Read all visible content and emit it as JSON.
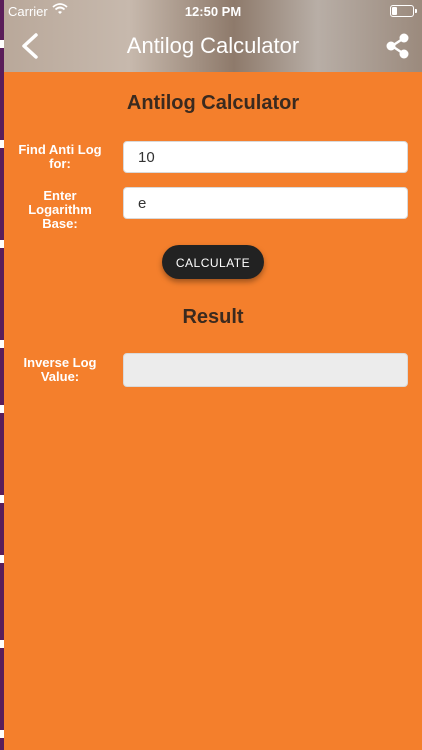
{
  "status_bar": {
    "carrier": "Carrier",
    "time": "12:50 PM"
  },
  "nav": {
    "title": "Antilog Calculator",
    "back_icon": "chevron-left-icon",
    "share_icon": "share-icon"
  },
  "form": {
    "heading": "Antilog Calculator",
    "antilog_label": "Find Anti Log for:",
    "antilog_value": "10",
    "base_label": "Enter Logarithm Base:",
    "base_value": "e",
    "calculate_label": "CALCULATE"
  },
  "result": {
    "heading": "Result",
    "inverse_label": "Inverse Log Value:",
    "inverse_value": ""
  },
  "colors": {
    "background": "#f47f2c",
    "button": "#222222",
    "heading_text": "#3a2a1f"
  }
}
